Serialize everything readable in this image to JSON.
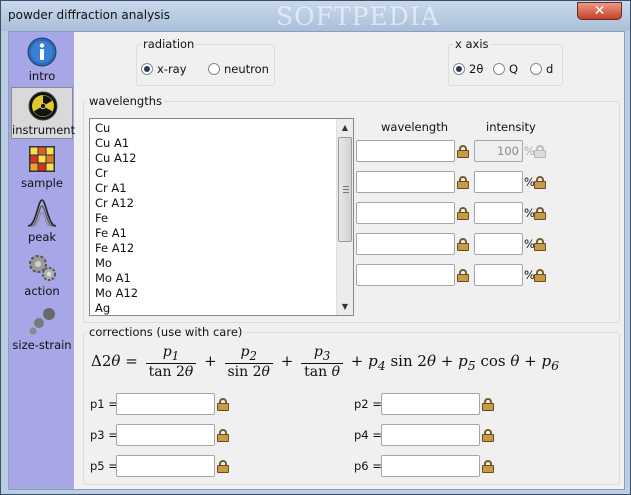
{
  "window": {
    "title": "powder diffraction analysis",
    "watermark": "SOFTPEDIA",
    "close_label": "✕"
  },
  "sidebar": {
    "items": [
      {
        "label": "intro",
        "icon": "info-icon",
        "selected": false
      },
      {
        "label": "instrument",
        "icon": "radiation-icon",
        "selected": true
      },
      {
        "label": "sample",
        "icon": "color-grid-icon",
        "selected": false
      },
      {
        "label": "peak",
        "icon": "peak-curve-icon",
        "selected": false
      },
      {
        "label": "action",
        "icon": "gears-icon",
        "selected": false
      },
      {
        "label": "size-strain",
        "icon": "dots-icon",
        "selected": false
      }
    ]
  },
  "radiation": {
    "label": "radiation",
    "options": [
      {
        "label": "x-ray",
        "selected": true
      },
      {
        "label": "neutron",
        "selected": false
      }
    ]
  },
  "x_axis": {
    "label": "x axis",
    "options": [
      {
        "label": "2θ",
        "selected": true
      },
      {
        "label": "Q",
        "selected": false
      },
      {
        "label": "d",
        "selected": false
      }
    ]
  },
  "wavelengths": {
    "label": "wavelengths",
    "items": [
      "Cu",
      "Cu A1",
      "Cu A12",
      "Cr",
      "Cr A1",
      "Cr A12",
      "Fe",
      "Fe A1",
      "Fe A12",
      "Mo",
      "Mo A1",
      "Mo A12",
      "Ag"
    ],
    "wavelength_header": "wavelength",
    "intensity_header": "intensity",
    "first_intensity": "100",
    "percent": "%"
  },
  "corrections": {
    "label": "corrections (use with care)",
    "params": [
      "p1 =",
      "p2 =",
      "p3 =",
      "p4 =",
      "p5 =",
      "p6 ="
    ]
  }
}
